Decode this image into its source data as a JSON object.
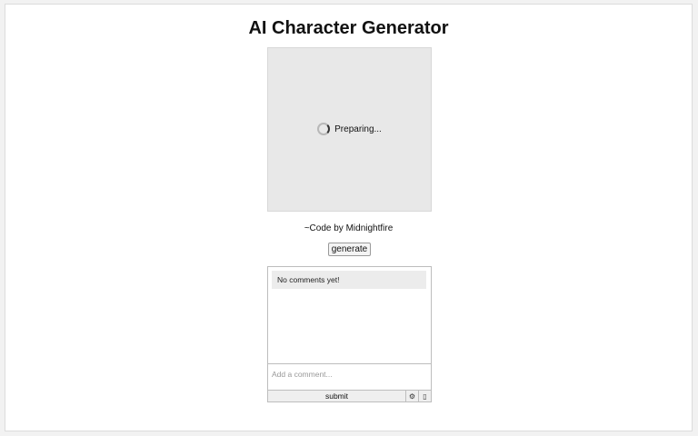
{
  "header": {
    "title": "AI Character Generator"
  },
  "preview": {
    "loading_text": "Preparing..."
  },
  "credit": {
    "text": "~Code by Midnightfire"
  },
  "actions": {
    "generate_label": "generate"
  },
  "comments": {
    "empty_text": "No comments yet!",
    "input_placeholder": "Add a comment...",
    "submit_label": "submit",
    "settings_icon": "⚙",
    "extra_icon": "▯"
  }
}
